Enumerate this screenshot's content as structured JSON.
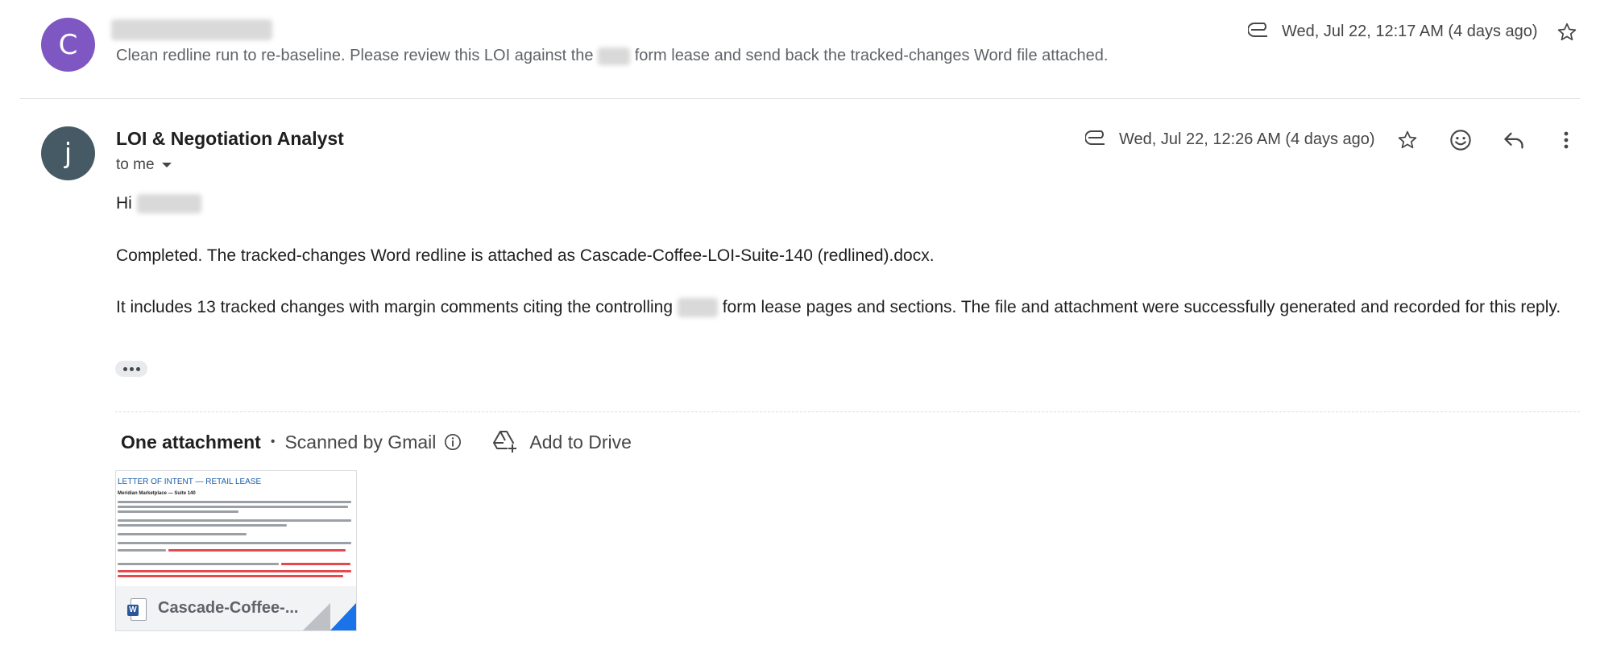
{
  "message1": {
    "avatar_letter": "C",
    "avatar_color": "#7e57c2",
    "snippet_before": "Clean redline run to re-baseline. Please review this LOI against the",
    "snippet_after": "form lease and send back the tracked-changes Word file attached.",
    "timestamp": "Wed, Jul 22, 12:17 AM (4 days ago)"
  },
  "message2": {
    "avatar_letter": "j",
    "avatar_color": "#455a64",
    "sender": "LOI & Negotiation Analyst",
    "to_label": "to me",
    "timestamp": "Wed, Jul 22, 12:26 AM (4 days ago)",
    "greeting": "Hi",
    "paragraph1": "Completed. The tracked-changes Word redline is attached as Cascade-Coffee-LOI-Suite-140 (redlined).docx.",
    "paragraph2_before": "It includes 13 tracked changes with margin comments citing the controlling",
    "paragraph2_after": "form lease pages and sections. The file and attachment were successfully generated and recorded for this reply."
  },
  "attachments": {
    "title": "One attachment",
    "separator": "•",
    "scanned": "Scanned by Gmail",
    "add_to_drive": "Add to Drive",
    "file_name": "Cascade-Coffee-...",
    "file_type_badge": "W",
    "preview": {
      "heading": "LETTER OF INTENT — RETAIL LEASE",
      "subheading": "Meridian Marketplace — Suite 140"
    }
  },
  "icons": {
    "attachment": "paperclip-icon",
    "star": "star-icon",
    "emoji": "emoji-icon",
    "reply": "reply-icon",
    "more": "more-vert-icon",
    "info": "info-icon",
    "drive": "add-to-drive-icon",
    "dropdown": "caret-down-icon"
  },
  "colors": {
    "divider": "#e0e0e0",
    "text_secondary": "#444746",
    "doc_blue": "#1a73e8"
  }
}
